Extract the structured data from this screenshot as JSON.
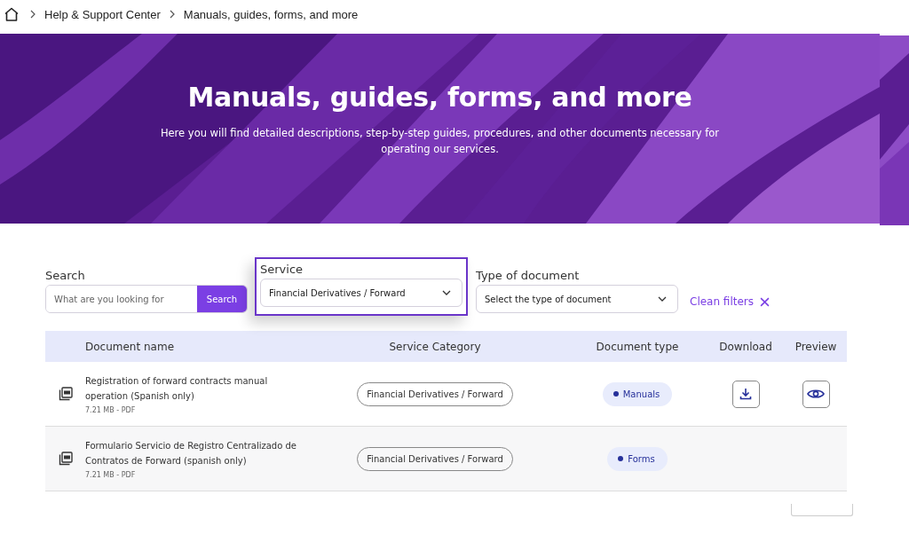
{
  "breadcrumb": [
    "Help & Support Center",
    "Manuals, guides, forms, and more"
  ],
  "hero": {
    "title": "Manuals, guides, forms, and more",
    "subtitle": "Here you will find detailed descriptions, step-by-step guides, procedures, and other documents necessary for operating our services."
  },
  "filters": {
    "search": {
      "label": "Search",
      "placeholder": "What are you looking for",
      "button": "Search"
    },
    "service": {
      "label": "Service",
      "value": "Financial Derivatives / Forward",
      "focused": true
    },
    "document_type": {
      "label": "Type of document",
      "placeholder": "Select the type of document"
    },
    "clear": "Clean filters"
  },
  "table": {
    "columns": [
      "Document name",
      "Service Category",
      "Document type",
      "Download",
      "Preview"
    ],
    "rows": [
      {
        "name": "Registration of forward contracts manual operation (Spanish only)",
        "meta": "7.21 MB - PDF",
        "category": "Financial Derivatives / Forward",
        "type": "Manuals",
        "download": true,
        "preview": true
      },
      {
        "name": "Formulario Servicio de Registro Centralizado de Contratos de Forward (spanish only)",
        "meta": "7.21 MB - PDF",
        "category": "Financial Derivatives / Forward",
        "type": "Forms",
        "download": false,
        "preview": false
      }
    ]
  }
}
